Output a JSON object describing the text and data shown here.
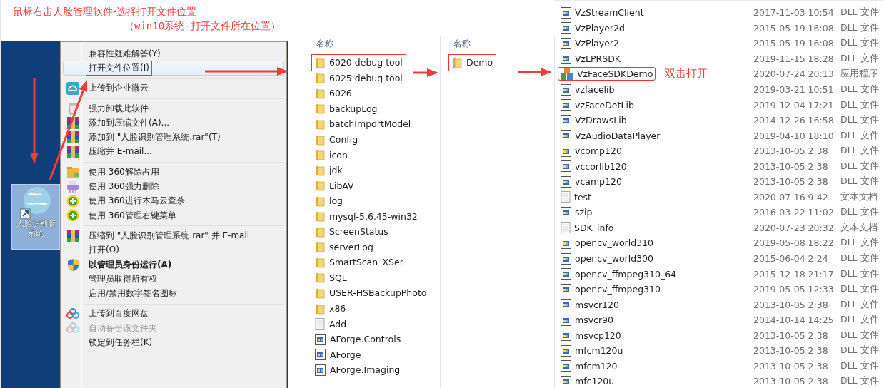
{
  "annotation": {
    "line_1": "鼠标右击人脸管理软件-选择打开文件位置",
    "line_2": "（win10系统-打开文件所在位置）"
  },
  "desktop_icon": {
    "label_lines": [
      "人脸识别管",
      "系统"
    ],
    "selected": true
  },
  "context_menu": [
    {
      "kind": "item",
      "label": "兼容性疑难解答(Y)",
      "selected": false,
      "highlighted_by_note": false,
      "disabled": false,
      "default": false
    },
    {
      "kind": "item",
      "label": "打开文件位置(I)",
      "selected": true,
      "highlighted_by_note": true,
      "disabled": false,
      "default": false
    },
    {
      "kind": "separator"
    },
    {
      "kind": "item",
      "label": "上传到企业微云",
      "selected": false,
      "highlighted_by_note": false,
      "disabled": false,
      "default": false
    },
    {
      "kind": "separator"
    },
    {
      "kind": "item",
      "label": "强力卸载此软件",
      "selected": false,
      "highlighted_by_note": false,
      "disabled": false,
      "default": false
    },
    {
      "kind": "item",
      "label": "添加到压缩文件(A)...",
      "selected": false,
      "highlighted_by_note": false,
      "disabled": false,
      "default": false
    },
    {
      "kind": "item",
      "label": "添加到 \"人脸识别管理系统.rar\"(T)",
      "selected": false,
      "highlighted_by_note": false,
      "disabled": false,
      "default": false
    },
    {
      "kind": "item",
      "label": "压缩并 E-mail...",
      "selected": false,
      "highlighted_by_note": false,
      "disabled": false,
      "default": false
    },
    {
      "kind": "separator"
    },
    {
      "kind": "item",
      "label": "使用 360解除占用",
      "selected": false,
      "highlighted_by_note": false,
      "disabled": false,
      "default": false
    },
    {
      "kind": "item",
      "label": "使用 360强力删除",
      "selected": false,
      "highlighted_by_note": false,
      "disabled": false,
      "default": false
    },
    {
      "kind": "item",
      "label": "使用 360进行木马云查杀",
      "selected": false,
      "highlighted_by_note": false,
      "disabled": false,
      "default": false
    },
    {
      "kind": "item",
      "label": "使用 360管理右键菜单",
      "selected": false,
      "highlighted_by_note": false,
      "disabled": false,
      "default": false
    },
    {
      "kind": "separator"
    },
    {
      "kind": "item",
      "label": "压缩到 \"人脸识别管理系统.rar\" 并 E-mail",
      "selected": false,
      "highlighted_by_note": false,
      "disabled": false,
      "default": false
    },
    {
      "kind": "item",
      "label": "打开(O)",
      "selected": false,
      "highlighted_by_note": false,
      "disabled": false,
      "default": false
    },
    {
      "kind": "item",
      "label": "以管理员身份运行(A)",
      "selected": false,
      "highlighted_by_note": false,
      "disabled": false,
      "default": true
    },
    {
      "kind": "item",
      "label": "管理员取得所有权",
      "selected": false,
      "highlighted_by_note": false,
      "disabled": false,
      "default": false
    },
    {
      "kind": "item",
      "label": "启用/禁用数字签名图标",
      "selected": false,
      "highlighted_by_note": false,
      "disabled": false,
      "default": false
    },
    {
      "kind": "separator"
    },
    {
      "kind": "item",
      "label": "上传到百度网盘",
      "selected": false,
      "highlighted_by_note": false,
      "disabled": false,
      "default": false
    },
    {
      "kind": "item",
      "label": "自动备份该文件夹",
      "selected": false,
      "highlighted_by_note": false,
      "disabled": true,
      "default": false
    },
    {
      "kind": "item",
      "label": "锁定到任务栏(K)",
      "selected": false,
      "highlighted_by_note": false,
      "disabled": false,
      "default": false
    }
  ],
  "folder_pane": {
    "column_header": "名称",
    "files": [
      {
        "name": "6020 debug tool",
        "kind": "folder",
        "highlighted_by_note": true
      },
      {
        "name": "6025 debug tool",
        "kind": "folder",
        "highlighted_by_note": false
      },
      {
        "name": "6026",
        "kind": "folder",
        "highlighted_by_note": false
      },
      {
        "name": "backupLog",
        "kind": "folder",
        "highlighted_by_note": false
      },
      {
        "name": "batchImportModel",
        "kind": "folder",
        "highlighted_by_note": false
      },
      {
        "name": "Config",
        "kind": "folder",
        "highlighted_by_note": false
      },
      {
        "name": "icon",
        "kind": "folder",
        "highlighted_by_note": false
      },
      {
        "name": "jdk",
        "kind": "folder",
        "highlighted_by_note": false
      },
      {
        "name": "LibAV",
        "kind": "folder",
        "highlighted_by_note": false
      },
      {
        "name": "log",
        "kind": "folder",
        "highlighted_by_note": false
      },
      {
        "name": "mysql-5.6.45-win32",
        "kind": "folder",
        "highlighted_by_note": false
      },
      {
        "name": "ScreenStatus",
        "kind": "folder",
        "highlighted_by_note": false
      },
      {
        "name": "serverLog",
        "kind": "folder",
        "highlighted_by_note": false
      },
      {
        "name": "SmartScan_XSer",
        "kind": "folder",
        "highlighted_by_note": false
      },
      {
        "name": "SQL",
        "kind": "folder",
        "highlighted_by_note": false
      },
      {
        "name": "USER-HSBackupPhoto",
        "kind": "folder",
        "highlighted_by_note": false
      },
      {
        "name": "x86",
        "kind": "folder",
        "highlighted_by_note": false
      },
      {
        "name": "Add",
        "kind": "text",
        "highlighted_by_note": false
      },
      {
        "name": "AForge.Controls",
        "kind": "dll",
        "highlighted_by_note": false
      },
      {
        "name": "AForge",
        "kind": "dll",
        "highlighted_by_note": false
      },
      {
        "name": "AForge.Imaging",
        "kind": "dll",
        "highlighted_by_note": false
      }
    ]
  },
  "demo_pane": {
    "column_header": "名称",
    "files": [
      {
        "name": "Demo",
        "kind": "folder",
        "highlighted_by_note": true
      }
    ]
  },
  "demo_files": {
    "note": "双击打开",
    "files": [
      {
        "name": "VzStreamClient",
        "date": "2017-11-03 10:54",
        "type": "DLL 文件",
        "kind": "dll",
        "highlighted_by_note": false
      },
      {
        "name": "VzPlayer2d",
        "date": "2015-05-19 16:08",
        "type": "DLL 文件",
        "kind": "dll",
        "highlighted_by_note": false
      },
      {
        "name": "VzPlayer2",
        "date": "2015-05-19 16:08",
        "type": "DLL 文件",
        "kind": "dll",
        "highlighted_by_note": false
      },
      {
        "name": "VzLPRSDK",
        "date": "2019-11-15 18:28",
        "type": "DLL 文件",
        "kind": "dll",
        "highlighted_by_note": false
      },
      {
        "name": "VzFaceSDKDemo",
        "date": "2020-07-24 20:13",
        "type": "应用程序",
        "kind": "app",
        "highlighted_by_note": true
      },
      {
        "name": "vzfacelib",
        "date": "2019-03-21 10:51",
        "type": "DLL 文件",
        "kind": "dll",
        "highlighted_by_note": false
      },
      {
        "name": "vzFaceDetLib",
        "date": "2019-12-04 17:21",
        "type": "DLL 文件",
        "kind": "dll",
        "highlighted_by_note": false
      },
      {
        "name": "VzDrawsLib",
        "date": "2014-12-26 16:58",
        "type": "DLL 文件",
        "kind": "dll",
        "highlighted_by_note": false
      },
      {
        "name": "VzAudioDataPlayer",
        "date": "2019-04-10 18:10",
        "type": "DLL 文件",
        "kind": "dll",
        "highlighted_by_note": false
      },
      {
        "name": "vcomp120",
        "date": "2013-10-05 2:38",
        "type": "DLL 文件",
        "kind": "dll",
        "highlighted_by_note": false
      },
      {
        "name": "vccorlib120",
        "date": "2013-10-05 2:38",
        "type": "DLL 文件",
        "kind": "dll",
        "highlighted_by_note": false
      },
      {
        "name": "vcamp120",
        "date": "2013-10-05 2:38",
        "type": "DLL 文件",
        "kind": "dll",
        "highlighted_by_note": false
      },
      {
        "name": "test",
        "date": "2020-07-16 9:42",
        "type": "文本文档",
        "kind": "text",
        "highlighted_by_note": false
      },
      {
        "name": "szip",
        "date": "2016-03-22 11:02",
        "type": "DLL 文件",
        "kind": "dll",
        "highlighted_by_note": false
      },
      {
        "name": "SDK_info",
        "date": "2020-07-23 20:32",
        "type": "文本文档",
        "kind": "text",
        "highlighted_by_note": false
      },
      {
        "name": "opencv_world310",
        "date": "2019-05-08 18:22",
        "type": "DLL 文件",
        "kind": "dll",
        "highlighted_by_note": false
      },
      {
        "name": "opencv_world300",
        "date": "2015-06-04 2:24",
        "type": "DLL 文件",
        "kind": "dll",
        "highlighted_by_note": false
      },
      {
        "name": "opencv_ffmpeg310_64",
        "date": "2015-12-18 21:17",
        "type": "DLL 文件",
        "kind": "dll",
        "highlighted_by_note": false
      },
      {
        "name": "opencv_ffmpeg310",
        "date": "2019-05-05 12:33",
        "type": "DLL 文件",
        "kind": "dll",
        "highlighted_by_note": false
      },
      {
        "name": "msvcr120",
        "date": "2013-10-05 2:38",
        "type": "DLL 文件",
        "kind": "dll",
        "highlighted_by_note": false
      },
      {
        "name": "msvcr90",
        "date": "2014-10-14 14:25",
        "type": "DLL 文件",
        "kind": "dll",
        "highlighted_by_note": false
      },
      {
        "name": "msvcp120",
        "date": "2013-10-05 2:38",
        "type": "DLL 文件",
        "kind": "dll",
        "highlighted_by_note": false
      },
      {
        "name": "mfcm120u",
        "date": "2013-10-05 2:38",
        "type": "DLL 文件",
        "kind": "dll",
        "highlighted_by_note": false
      },
      {
        "name": "mfcm120",
        "date": "2013-10-05 2:38",
        "type": "DLL 文件",
        "kind": "dll",
        "highlighted_by_note": false
      },
      {
        "name": "mfc120u",
        "date": "2013-10-05 2:38",
        "type": "DLL 文件",
        "kind": "dll",
        "highlighted_by_note": false
      }
    ]
  }
}
